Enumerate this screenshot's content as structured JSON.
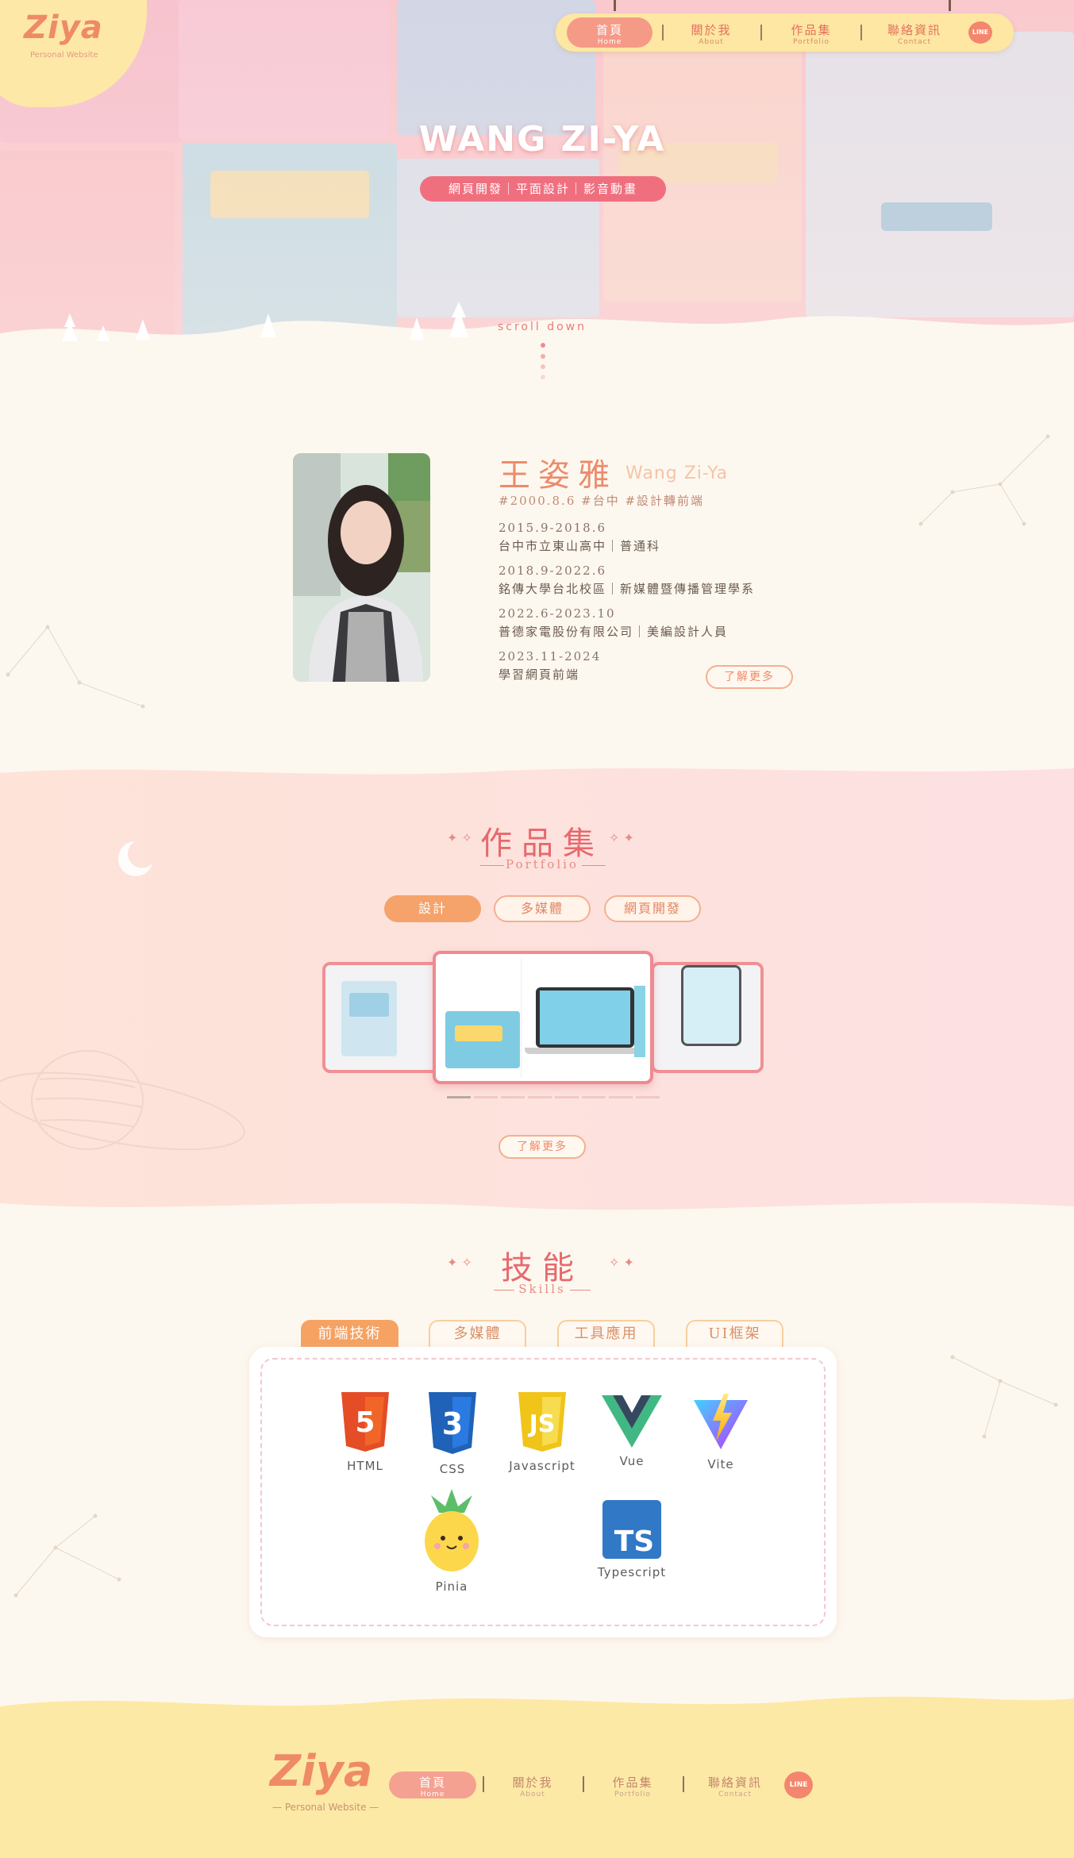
{
  "brand": {
    "logo_text": "Ziya",
    "logo_sub": "Personal Website"
  },
  "nav": {
    "items": [
      {
        "zh": "首頁",
        "en": "Home"
      },
      {
        "zh": "關於我",
        "en": "About"
      },
      {
        "zh": "作品集",
        "en": "Portfolio"
      },
      {
        "zh": "聯絡資訊",
        "en": "Contact"
      }
    ],
    "line_label": "LINE"
  },
  "hero": {
    "title": "WANG ZI-YA",
    "tags": "網頁開發｜平面設計｜影音動畫",
    "scroll_hint": "scroll down"
  },
  "about": {
    "name": "王姿雅",
    "name_en": "Wang Zi-Ya",
    "tags": "#2000.8.6 #台中 #設計轉前端",
    "timeline": [
      {
        "date": "2015.9-2018.6",
        "desc": "台中市立東山高中｜普通科"
      },
      {
        "date": "2018.9-2022.6",
        "desc": "銘傳大學台北校區｜新媒體暨傳播管理學系"
      },
      {
        "date": "2022.6-2023.10",
        "desc": "普德家電股份有限公司｜美編設計人員"
      },
      {
        "date": "2023.11-2024",
        "desc": "學習網頁前端"
      }
    ],
    "more_label": "了解更多"
  },
  "portfolio": {
    "title": "作品集",
    "subtitle": "Portfolio",
    "tabs": [
      "設計",
      "多媒體",
      "網頁開發"
    ],
    "active_tab": 0,
    "slides": 8,
    "active_slide": 0,
    "more_label": "了解更多"
  },
  "skills": {
    "title": "技能",
    "subtitle": "Skills",
    "tabs": [
      "前端技術",
      "多媒體",
      "工具應用",
      "UI框架"
    ],
    "active_tab": 0,
    "items": [
      {
        "label": "HTML",
        "icon": "html5-icon"
      },
      {
        "label": "CSS",
        "icon": "css3-icon"
      },
      {
        "label": "Javascript",
        "icon": "js-icon"
      },
      {
        "label": "Vue",
        "icon": "vue-icon"
      },
      {
        "label": "Vite",
        "icon": "vite-icon"
      },
      {
        "label": "Pinia",
        "icon": "pinia-icon"
      },
      {
        "label": "Typescript",
        "icon": "ts-icon"
      }
    ]
  },
  "footer": {
    "logo_text": "Ziya",
    "logo_sub": "— Personal Website —",
    "items": [
      {
        "zh": "首頁",
        "en": "Home"
      },
      {
        "zh": "關於我",
        "en": "About"
      },
      {
        "zh": "作品集",
        "en": "Portfolio"
      },
      {
        "zh": "聯絡資訊",
        "en": "Contact"
      }
    ],
    "line_label": "LINE"
  },
  "colors": {
    "accent": "#ef8a67",
    "pink": "#e7696e",
    "band": "#fde0dc",
    "footer": "#fde9a6"
  }
}
